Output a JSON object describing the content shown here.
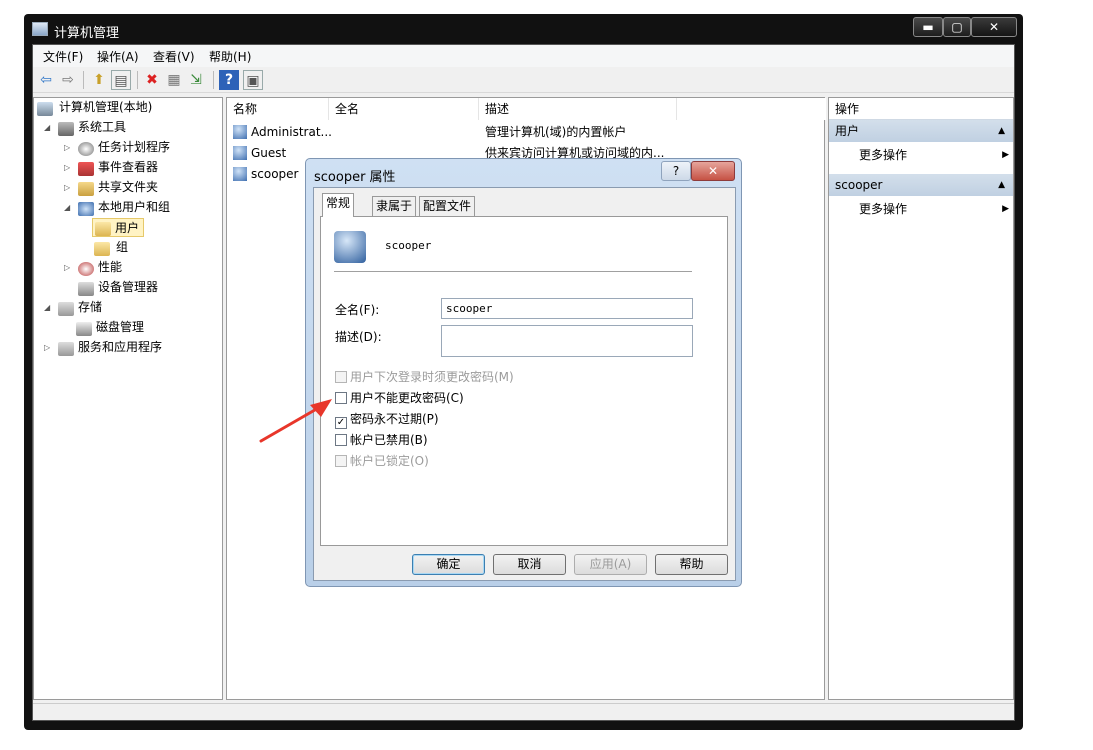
{
  "window": {
    "title": "计算机管理",
    "min": "▬",
    "max": "▢",
    "close": "✕"
  },
  "menu": [
    "文件(F)",
    "操作(A)",
    "查看(V)",
    "帮助(H)"
  ],
  "toolbar": {
    "back": "⇦",
    "forward": "⇨",
    "up": "⬆",
    "show_hide": "▤",
    "delete": "✖",
    "properties": "▦",
    "export": "⇲",
    "help": "?",
    "view": "▣"
  },
  "tree": {
    "root": "计算机管理(本地)",
    "system_tools": "系统工具",
    "task_scheduler": "任务计划程序",
    "event_viewer": "事件查看器",
    "shared_folders": "共享文件夹",
    "local_users": "本地用户和组",
    "users": "用户",
    "groups": "组",
    "performance": "性能",
    "device_manager": "设备管理器",
    "storage": "存储",
    "disk_management": "磁盘管理",
    "services": "服务和应用程序"
  },
  "list": {
    "columns": [
      "名称",
      "全名",
      "描述"
    ],
    "rows": [
      {
        "name": "Administrat...",
        "fullname": "",
        "desc": "管理计算机(域)的内置帐户"
      },
      {
        "name": "Guest",
        "fullname": "",
        "desc": "供来宾访问计算机或访问域的内..."
      },
      {
        "name": "scooper",
        "fullname": "",
        "desc": ""
      }
    ]
  },
  "actions": {
    "header": "操作",
    "section1": "用户",
    "section2": "scooper",
    "more": "更多操作"
  },
  "dialog": {
    "title": "scooper 属性",
    "help": "?",
    "close": "✕",
    "tabs": [
      "常规",
      "隶属于",
      "配置文件"
    ],
    "username": "scooper",
    "fullname_label": "全名(F):",
    "fullname_value": "scooper",
    "desc_label": "描述(D):",
    "desc_value": "",
    "checkboxes": [
      {
        "label": "用户下次登录时须更改密码(M)",
        "checked": false,
        "disabled": true
      },
      {
        "label": "用户不能更改密码(C)",
        "checked": false,
        "disabled": false
      },
      {
        "label": "密码永不过期(P)",
        "checked": true,
        "disabled": false
      },
      {
        "label": "帐户已禁用(B)",
        "checked": false,
        "disabled": false
      },
      {
        "label": "帐户已锁定(O)",
        "checked": false,
        "disabled": true
      }
    ],
    "check_mark": "✓",
    "buttons": {
      "ok": "确定",
      "cancel": "取消",
      "apply": "应用(A)",
      "help": "帮助"
    }
  },
  "colors": {
    "arrow": "#e8362a",
    "selected": "#fff3c4"
  }
}
